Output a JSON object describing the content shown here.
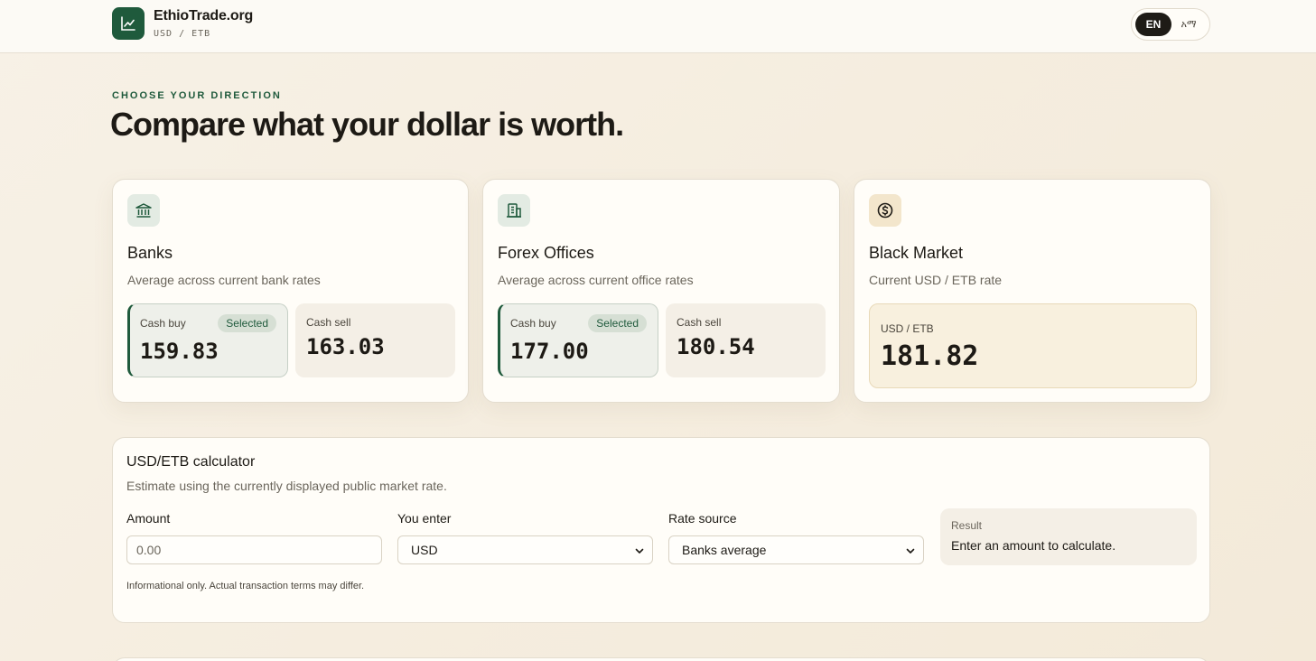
{
  "brand": {
    "name": "EthioTrade.org",
    "pair": "USD / ETB"
  },
  "lang": {
    "active": "EN",
    "other": "አማ"
  },
  "intro": {
    "eyebrow": "CHOOSE YOUR DIRECTION",
    "headline": "Compare what your dollar is worth."
  },
  "cards": [
    {
      "icon": "bank-icon",
      "title": "Banks",
      "subtitle": "Average across current bank rates",
      "buy_label": "Cash buy",
      "buy_value": "159.83",
      "selected_label": "Selected",
      "sell_label": "Cash sell",
      "sell_value": "163.03"
    },
    {
      "icon": "building-icon",
      "title": "Forex Offices",
      "subtitle": "Average across current office rates",
      "buy_label": "Cash buy",
      "buy_value": "177.00",
      "selected_label": "Selected",
      "sell_label": "Cash sell",
      "sell_value": "180.54"
    },
    {
      "icon": "dollar-coin-icon",
      "title": "Black Market",
      "subtitle": "Current USD / ETB rate",
      "rate_label": "USD / ETB",
      "rate_value": "181.82"
    }
  ],
  "calculator": {
    "title": "USD/ETB calculator",
    "subtitle": "Estimate using the currently displayed public market rate.",
    "amount_label": "Amount",
    "amount_placeholder": "0.00",
    "currency_label": "You enter",
    "currency_value": "USD",
    "source_label": "Rate source",
    "source_value": "Banks average",
    "result_label": "Result",
    "result_text": "Enter an amount to calculate.",
    "note": "Informational only. Actual transaction terms may differ."
  },
  "colors": {
    "accent": "#1f5a3c",
    "background": "#f7f1e6",
    "card": "#fffdf8",
    "highlight": "#f8f0de"
  }
}
